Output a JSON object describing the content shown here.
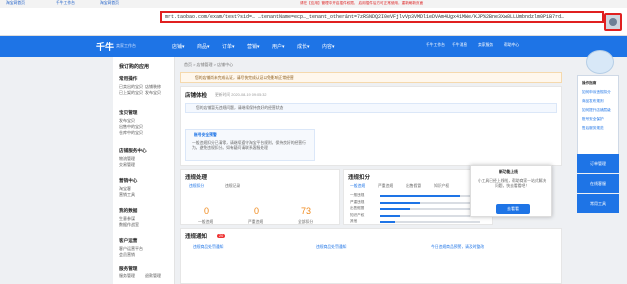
{
  "browser": {
    "tabs": [
      "淘宝网首页",
      "千牛工作台",
      "淘宝网首页"
    ],
    "url": "mrt.taobao.com/exam/test?sid=…    …tenantName=ecp…_tenant_other&nt=7zRSNDQ2I0eVFjlvVp3VMDl1eDVAm4Ugx41MWe/KJP%2Bne3Xw8LLUmbndzlm0P1B7rd…",
    "banner": "请在【应用】管理中开启插件权限，  启用插件后方可正常使用，重新刷新页面"
  },
  "header": {
    "logo": "千牛",
    "logo_sub": "卖家工作台",
    "nav": [
      "店铺▾",
      "商品▾",
      "订单▾",
      "营销▾",
      "用户▾",
      "成长▾",
      "内容▾"
    ],
    "right_items": [
      "千牛工作台",
      "千牛消息",
      "卖家服务",
      "帮助中心"
    ]
  },
  "sidebar": {
    "title": "我订购的应用",
    "sections": [
      {
        "head": "常用操作",
        "items": [
          "已卖出的宝贝",
          "店铺装修",
          "已上架的宝贝",
          "发布宝贝"
        ]
      },
      {
        "head": "宝贝管理",
        "items": [
          "发布宝贝",
          "出售中的宝贝",
          "仓库中的宝贝"
        ]
      },
      {
        "head": "店铺服务中心",
        "items": [
          "物流管理",
          "交易管理"
        ]
      },
      {
        "head": "营销中心",
        "items": [
          "淘宝客",
          "营销工具"
        ]
      },
      {
        "head": "我的数据",
        "items": [
          "生意参谋",
          "数据作战室"
        ]
      },
      {
        "head": "客户运营",
        "items": [
          "客户运营平台",
          "会员营销"
        ]
      },
      {
        "head": "服务管理",
        "items": [
          "服务管理",
          "退款管理",
          "投诉管理"
        ]
      }
    ]
  },
  "crumb": "首页 > 店铺管理 > 店铺中心",
  "notice": "您的店铺尚未完成认证，请尽快完成认证以免影响正常经营",
  "store": {
    "title": "店铺体检",
    "time": "更新时间 2020-08-19 09:05:32",
    "status": "您的店铺暂无违规问题，请继续保持良好的经营状态",
    "security_title": "账号安全预警",
    "security_text": "一般违规扣分已清零，请继续遵守淘宝平台规则，保持良好的经营行为，避免违规扣分。如有疑问请联系客服处理"
  },
  "violations": {
    "title": "违规处理",
    "tabs": [
      "违规扣分",
      "违规记录"
    ],
    "stats": [
      {
        "label": "一般违规",
        "value": "0"
      },
      {
        "label": "严重违规",
        "value": "0"
      },
      {
        "label": "全部扣分",
        "value": "73"
      }
    ]
  },
  "score": {
    "title": "违规扣分",
    "tabs": [
      "一般违规",
      "严重违规",
      "出售假冒",
      "知识产权"
    ],
    "rows": [
      {
        "label": "一般违规",
        "value": 0.8
      },
      {
        "label": "严重违规",
        "value": 0.4
      },
      {
        "label": "出售假冒",
        "value": 0.3
      },
      {
        "label": "知识产权",
        "value": 0.2
      },
      {
        "label": "其他",
        "value": 0.15
      }
    ]
  },
  "bulletin": {
    "title": "违规通知",
    "count": "20",
    "items": [
      "违规商品处罚通知",
      "违规商品处罚通知",
      "今日违规商品预警，请及时整改"
    ]
  },
  "right_panel": {
    "items": [
      "操作指南",
      "如何申诉违规扣分",
      "商品发布规则",
      "如何提升店铺层级",
      "账号安全保护",
      "售后服务规范"
    ],
    "buttons": [
      "订单管理",
      "在线客服",
      "常用工具"
    ]
  },
  "popup": {
    "title": "新功能上线",
    "text": "小工具已经上线啦，帮助商家一站式解决问题，快去看看吧！",
    "button": "去看看"
  }
}
